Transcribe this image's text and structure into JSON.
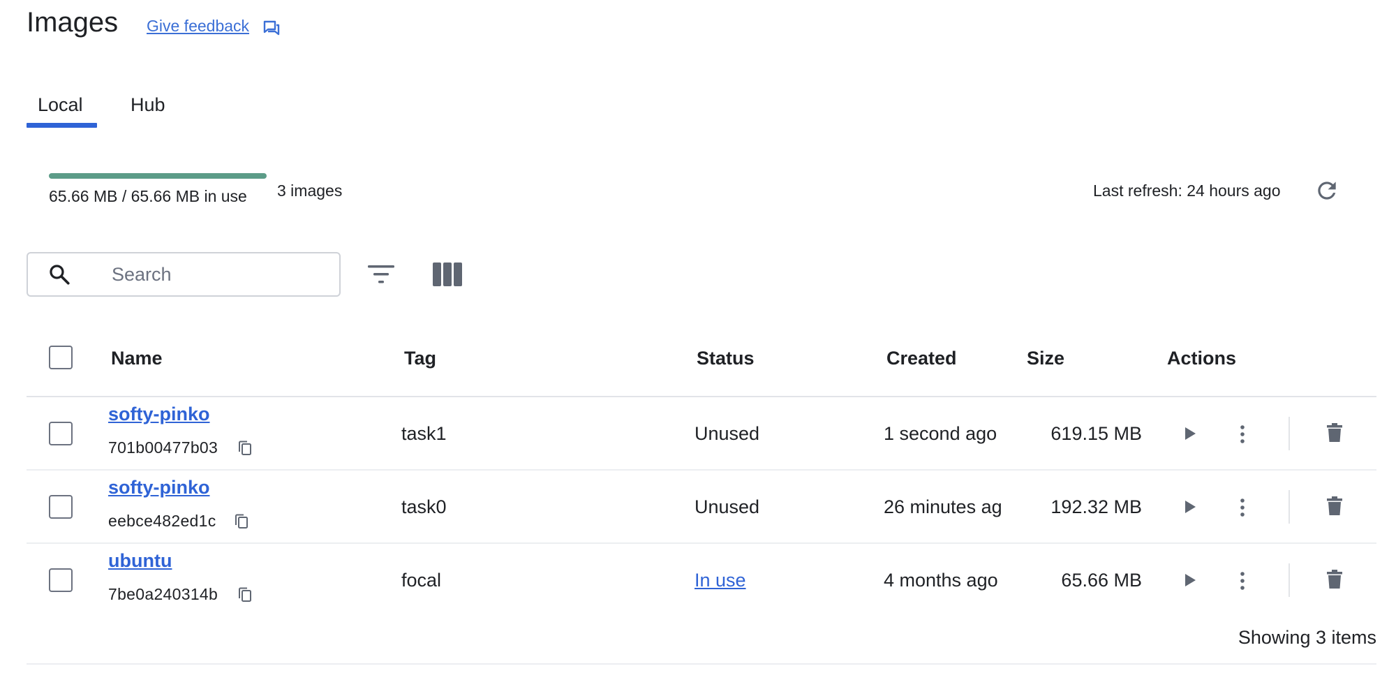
{
  "header": {
    "title": "Images",
    "feedback_label": "Give feedback",
    "feedback_icon": "feedback-icon"
  },
  "tabs": [
    {
      "label": "Local",
      "active": true
    },
    {
      "label": "Hub",
      "active": false
    }
  ],
  "usage": {
    "text": "65.66 MB / 65.66 MB in use",
    "fraction": 1.0,
    "bar_color": "#5c9c88",
    "image_count": "3 images"
  },
  "refresh": {
    "label": "Last refresh: 24 hours ago",
    "icon": "refresh-icon"
  },
  "toolbar": {
    "search_placeholder": "Search",
    "search_value": "",
    "filter_icon": "filter-icon",
    "columns_icon": "columns-icon"
  },
  "table": {
    "headers": [
      "Name",
      "Tag",
      "Status",
      "Created",
      "Size",
      "Actions"
    ],
    "rows": [
      {
        "name": "softy-pinko",
        "id": "701b00477b03",
        "tag": "task1",
        "status": "Unused",
        "created": "1 second ago",
        "size": "619.15 MB"
      },
      {
        "name": "softy-pinko",
        "id": "eebce482ed1c",
        "tag": "task0",
        "status": "Unused",
        "created": "26 minutes ag",
        "size": "192.32 MB"
      },
      {
        "name": "ubuntu",
        "id": "7be0a240314b",
        "tag": "focal",
        "status": "In use",
        "created": "4 months ago",
        "size": "65.66 MB"
      }
    ],
    "footer": "Showing 3 items"
  },
  "colors": {
    "accent": "#2f63d6",
    "link": "#3b6fd6",
    "usage_bar": "#5c9c88",
    "icon_gray": "#5f6672"
  }
}
